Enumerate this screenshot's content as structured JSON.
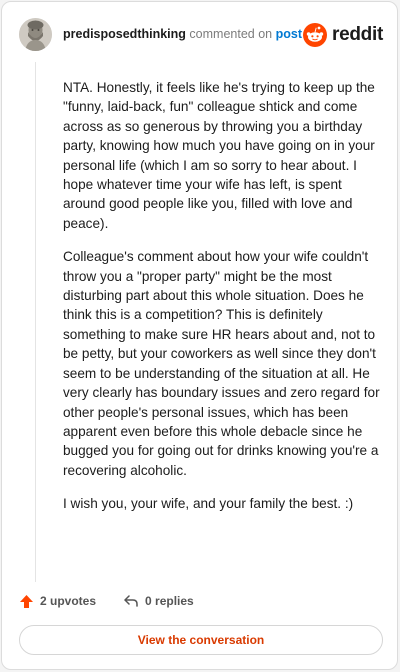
{
  "header": {
    "author": "predisposedthinking",
    "action_text": "commented on",
    "post_link": "post",
    "brand": "reddit"
  },
  "comment": {
    "paragraphs": [
      "NTA. Honestly, it feels like he's trying to keep up the \"funny, laid-back, fun\" colleague shtick and come across as so generous by throwing you a birthday party, knowing how much you have going on in your personal life (which I am so sorry to hear about. I hope whatever time your wife has left, is spent around good people like you, filled with love and peace).",
      "Colleague's comment about how your wife couldn't throw you a \"proper party\" might be the most disturbing part about this whole situation. Does he think this is a competition? This is definitely something to make sure HR hears about and, not to be petty, but your coworkers as well since they don't seem to be understanding of the situation at all. He very clearly has boundary issues and zero regard for other people's personal issues, which has been apparent even before this whole debacle since he bugged you for going out for drinks knowing you're a recovering alcoholic.",
      "I wish you, your wife, and your family the best. :)"
    ]
  },
  "actions": {
    "upvotes": "2 upvotes",
    "replies": "0 replies"
  },
  "footer": {
    "view_button": "View the conversation"
  },
  "colors": {
    "brand_orange": "#ff4500",
    "link_blue": "#0079d3",
    "button_text": "#d93a00"
  }
}
